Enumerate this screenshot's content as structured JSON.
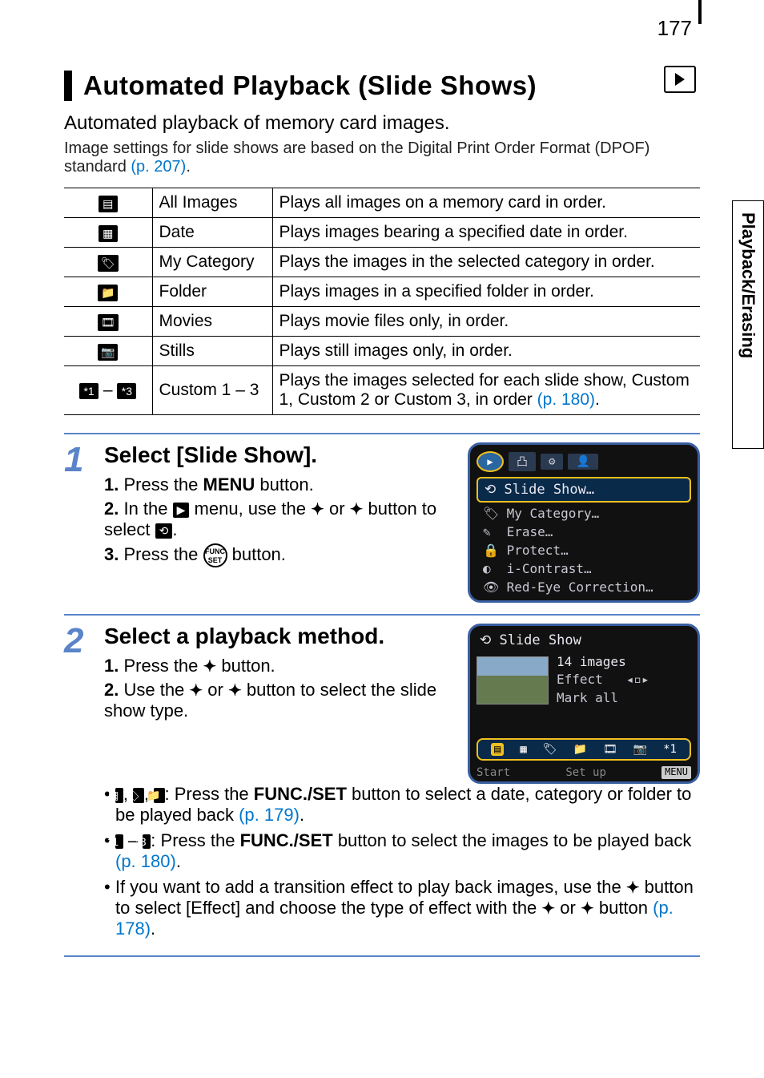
{
  "page_number": "177",
  "side_tab": "Playback/Erasing",
  "title": "Automated Playback (Slide Shows)",
  "intro_line1": "Automated playback of memory card images.",
  "intro_line2a": "Image settings for slide shows are based on the Digital Print Order Format (DPOF) standard ",
  "intro_line2_link": "(p. 207)",
  "intro_line2b": ".",
  "options": [
    {
      "icon": "▤",
      "label": "All Images",
      "desc": "Plays all images on a memory card in order."
    },
    {
      "icon": "▦",
      "label": "Date",
      "desc": "Plays images bearing a specified date in order."
    },
    {
      "icon": "🏷",
      "label": "My Category",
      "desc": "Plays the images in the selected category in order."
    },
    {
      "icon": "📁",
      "label": "Folder",
      "desc": "Plays images in a specified folder in order."
    },
    {
      "icon": "🎞",
      "label": "Movies",
      "desc": "Plays movie files only, in order."
    },
    {
      "icon": "📷",
      "label": "Stills",
      "desc": "Plays still images only, in order."
    }
  ],
  "custom_row": {
    "icon_from": "*1",
    "icon_dash": " – ",
    "icon_to": "*3",
    "label": "Custom 1 – 3",
    "desc_a": "Plays the images selected for each slide show, Custom 1, Custom 2 or Custom 3, in order ",
    "desc_link": "(p. 180)",
    "desc_b": "."
  },
  "steps": [
    {
      "num": "1",
      "title": "Select [Slide Show].",
      "sub": [
        {
          "n": "1.",
          "before": "Press the ",
          "bold": "MENU",
          "after": " button."
        },
        {
          "n": "2.",
          "text_parts": {
            "a": "In the ",
            "icon1": "▶",
            "b": " menu, use the ",
            "up": "✦",
            "c": " or ",
            "down": "✦",
            "d": " button to select ",
            "icon2": "⟲",
            "e": "."
          }
        },
        {
          "n": "3.",
          "before": "Press the ",
          "func": "FUNC SET",
          "after": " button."
        }
      ],
      "screenshot": {
        "highlight": "Slide Show…",
        "rows": [
          {
            "ico": "🏷",
            "txt": "My Category…"
          },
          {
            "ico": "✎",
            "txt": "Erase…"
          },
          {
            "ico": "🔒",
            "txt": "Protect…"
          },
          {
            "ico": "◐",
            "txt": "i-Contrast…"
          },
          {
            "ico": "👁",
            "txt": "Red-Eye Correction…"
          }
        ]
      }
    },
    {
      "num": "2",
      "title": "Select a playback method.",
      "sub": [
        {
          "n": "1.",
          "before": "Press the ",
          "up": "✦",
          "after": " button."
        },
        {
          "n": "2.",
          "before": "Use the ",
          "left": "✦",
          "mid": " or ",
          "right": "✦",
          "after": " button to select the slide show type."
        }
      ],
      "bullets": [
        {
          "icons": [
            "▦",
            "🏷",
            "📁"
          ],
          "a": ": Press the ",
          "bold": "FUNC./SET",
          "b": " button to select a date, category or folder to be played back ",
          "link": "(p. 179)",
          "c": "."
        },
        {
          "icon_from": "*1",
          "dash": " – ",
          "icon_to": "*3",
          "a": ": Press the ",
          "bold": "FUNC./SET",
          "b": " button to select the images to be played back ",
          "link": "(p. 180)",
          "c": "."
        },
        {
          "a": "If you want to add a transition effect to play back images, use the ",
          "up": "✦",
          "b": " button to select [Effect] and choose the type of effect with the ",
          "left": "✦",
          "c": " or ",
          "right": "✦",
          "d": " button ",
          "link": "(p. 178)",
          "e": "."
        }
      ],
      "screenshot": {
        "title": "Slide Show",
        "count": "14 images",
        "effect_label": "Effect",
        "mark": "Mark all",
        "bottom": {
          "start": "Start",
          "setup": "Set up",
          "menu": "MENU"
        }
      }
    }
  ]
}
